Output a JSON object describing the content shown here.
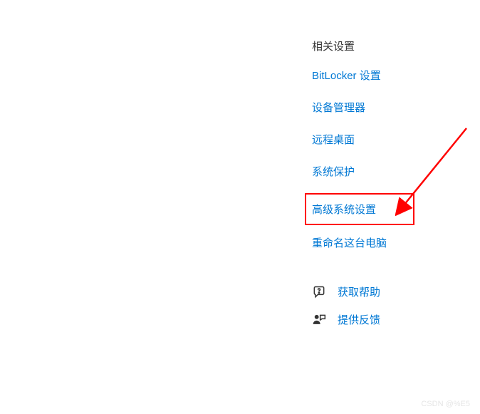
{
  "related_settings": {
    "title": "相关设置",
    "links": [
      {
        "label": "BitLocker 设置",
        "highlighted": false
      },
      {
        "label": "设备管理器",
        "highlighted": false
      },
      {
        "label": "远程桌面",
        "highlighted": false
      },
      {
        "label": "系统保护",
        "highlighted": false
      },
      {
        "label": "高级系统设置",
        "highlighted": true
      },
      {
        "label": "重命名这台电脑",
        "highlighted": false
      }
    ]
  },
  "help_section": {
    "items": [
      {
        "icon": "chat-question",
        "label": "获取帮助"
      },
      {
        "icon": "feedback",
        "label": "提供反馈"
      }
    ]
  },
  "watermark": "CSDN @%E5"
}
